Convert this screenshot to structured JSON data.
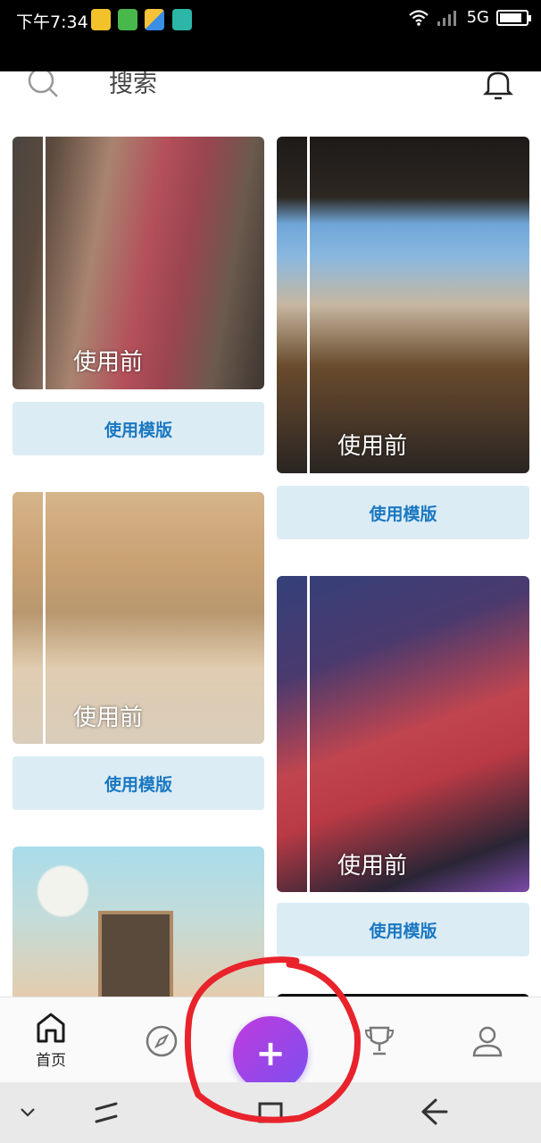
{
  "status_bar": {
    "time": "下午7:34",
    "network": "5G",
    "battery_level": 0.85,
    "icons": [
      "folder-app-icon",
      "android-app-icon",
      "photo-app-icon",
      "scan-app-icon",
      "wifi-icon",
      "signal-icon",
      "battery-icon"
    ]
  },
  "header": {
    "search_placeholder": "搜索",
    "icons": [
      "search-icon",
      "bell-icon"
    ]
  },
  "feed": {
    "before_label": "使用前",
    "cards": [
      {
        "before_label": "使用前",
        "button_label": "使用模版"
      },
      {
        "before_label": "使用前",
        "button_label": "使用模版"
      },
      {
        "before_label": "使用前",
        "button_label": "使用模版"
      },
      {
        "before_label": "使用前",
        "button_label": "使用模版"
      },
      {
        "before_label": "",
        "button_label": ""
      }
    ]
  },
  "bottom_nav": {
    "home_label": "首页",
    "items": [
      "home-icon",
      "compass-icon",
      "add-icon",
      "trophy-icon",
      "profile-icon"
    ],
    "fab_symbol": "+"
  },
  "colors": {
    "accent": "#1a78c2",
    "button_bg": "#dcecf5",
    "fab_start": "#c03bdc",
    "fab_end": "#7a4ff0",
    "annotation": "#e8232c"
  }
}
